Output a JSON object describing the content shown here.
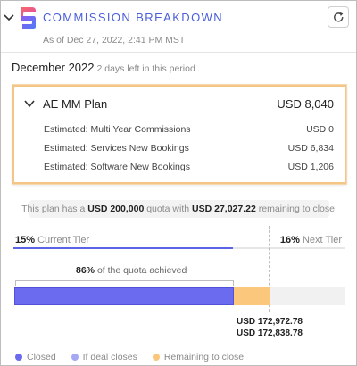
{
  "header": {
    "title": "COMMISSION BREAKDOWN",
    "as_of": "As of Dec 27, 2022, 2:41 PM MST",
    "logo": "spiff-logo",
    "collapse_icon": "chevron-down-icon",
    "refresh_icon": "refresh-icon"
  },
  "period": {
    "name": "December 2022",
    "days_left": "2 days left in this period"
  },
  "plan": {
    "name": "AE MM Plan",
    "total": "USD 8,040",
    "rows": [
      {
        "label": "Estimated: Multi Year Commissions",
        "value": "USD 0"
      },
      {
        "label": "Estimated: Services New Bookings",
        "value": "USD 6,834"
      },
      {
        "label": "Estimated: Software New Bookings",
        "value": "USD 1,206"
      }
    ]
  },
  "quota_note": {
    "prefix": "This plan has a",
    "quota": "USD 200,000",
    "middle": "quota with",
    "remaining": "USD 27,027.22",
    "suffix": "remaining to close."
  },
  "tiers": {
    "current_pct": "15%",
    "current_label": "Current Tier",
    "next_pct": "16%",
    "next_label": "Next Tier",
    "progress_fraction": 0.66
  },
  "achievement": {
    "pct": "86%",
    "text": "of the quota achieved",
    "closed_fraction": 0.664,
    "remaining_fraction": 0.11
  },
  "amounts": {
    "line1": "USD 172,972.78",
    "line2": "USD 172,838.78"
  },
  "legend": [
    {
      "label": "Closed",
      "color": "#6b6bf0"
    },
    {
      "label": "If deal closes",
      "color": "#a4a8f5"
    },
    {
      "label": "Remaining to close",
      "color": "#fbc77c"
    }
  ],
  "colors": {
    "accent": "#4a5fd9",
    "highlight_border": "#f3c586"
  }
}
